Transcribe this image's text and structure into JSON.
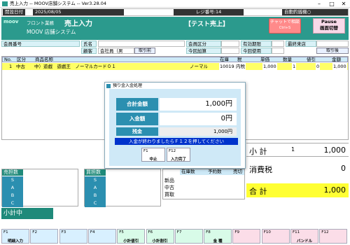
{
  "window": {
    "title": "売上入力 -- MOOV店舗システム -- Ver3.28.04"
  },
  "infobar": {
    "date_label": "開設日付",
    "date": "2025/08/05",
    "register_label": "レジ番号:14",
    "auto_close": "自動釣銭機○"
  },
  "header": {
    "dept": "フロント業務",
    "title": "売上入力",
    "mode": "【テスト売上】",
    "logo": "moov",
    "store": "MOOV 店舗システム",
    "chat_btn": "チャットで相談",
    "chat_sub": "Ctrl+S",
    "pause": "Pause",
    "pause_sub": "画面切替"
  },
  "customer": {
    "member_no": "会員番号",
    "name": "氏名",
    "member_type": "会員区分",
    "expiry": "有効期限",
    "last_visit": "最終来店",
    "customer": "顧客",
    "customer_val": "会社員（男",
    "cancel": "取引前",
    "points_today": "今回加算",
    "points_use": "今回使用",
    "history": "取引後"
  },
  "table": {
    "headers": [
      "No.",
      "区分",
      "商品名称",
      "在庫",
      "税",
      "単価",
      "数量",
      "値引",
      "金額"
    ],
    "row": {
      "no": "1",
      "kubun": "中古",
      "name": "中）遊戯　遊戯王　ノーマルカード０１",
      "cond": "ノーマル",
      "stock": "10019",
      "tax": "内税",
      "price": "1,000",
      "qty": "1",
      "disc": "0",
      "amount": "1,000"
    }
  },
  "dialog": {
    "title": "預り金入金処理",
    "total_label": "合計金額",
    "total": "1,000円",
    "paid_label": "入金額",
    "paid": "0円",
    "change_label": "残金",
    "change": "1,000円",
    "message": "入金が終わりましたらＦ１２を押してください",
    "f1": "F1",
    "f1_label": "中止",
    "f12": "F12",
    "f12_label": "入力完了"
  },
  "left": {
    "sell_title": "売担数",
    "buy_title": "買担数",
    "ranks": [
      "S",
      "A",
      "B",
      "C"
    ],
    "subtotal_mid": "小計中"
  },
  "stockbox": {
    "headers": [
      "在庫数",
      "予約数",
      "売切"
    ],
    "rows": [
      "新品",
      "中古",
      "買取"
    ]
  },
  "summary": {
    "subtotal_label": "小 計",
    "subtotal_qty": "1",
    "subtotal": "1,000",
    "tax_label": "消費税",
    "tax": "0",
    "total_label": "合 計",
    "total": "1,000"
  },
  "fkeys": [
    {
      "n": "F1",
      "l": "明細入力"
    },
    {
      "n": "F2",
      "l": ""
    },
    {
      "n": "F3",
      "l": ""
    },
    {
      "n": "F4",
      "l": ""
    },
    {
      "n": "F5",
      "l": "小計値引"
    },
    {
      "n": "F6",
      "l": "小計割引"
    },
    {
      "n": "F7",
      "l": ""
    },
    {
      "n": "F8",
      "l": "金 種"
    },
    {
      "n": "F9",
      "l": ""
    },
    {
      "n": "F10",
      "l": ""
    },
    {
      "n": "F11",
      "l": "バンドル"
    },
    {
      "n": "F12",
      "l": ""
    }
  ],
  "colors": {
    "teal": "#2b9a8d",
    "yellow": "#ffff66",
    "blue": "#2b8fb0",
    "green": "#1f8a7a"
  }
}
